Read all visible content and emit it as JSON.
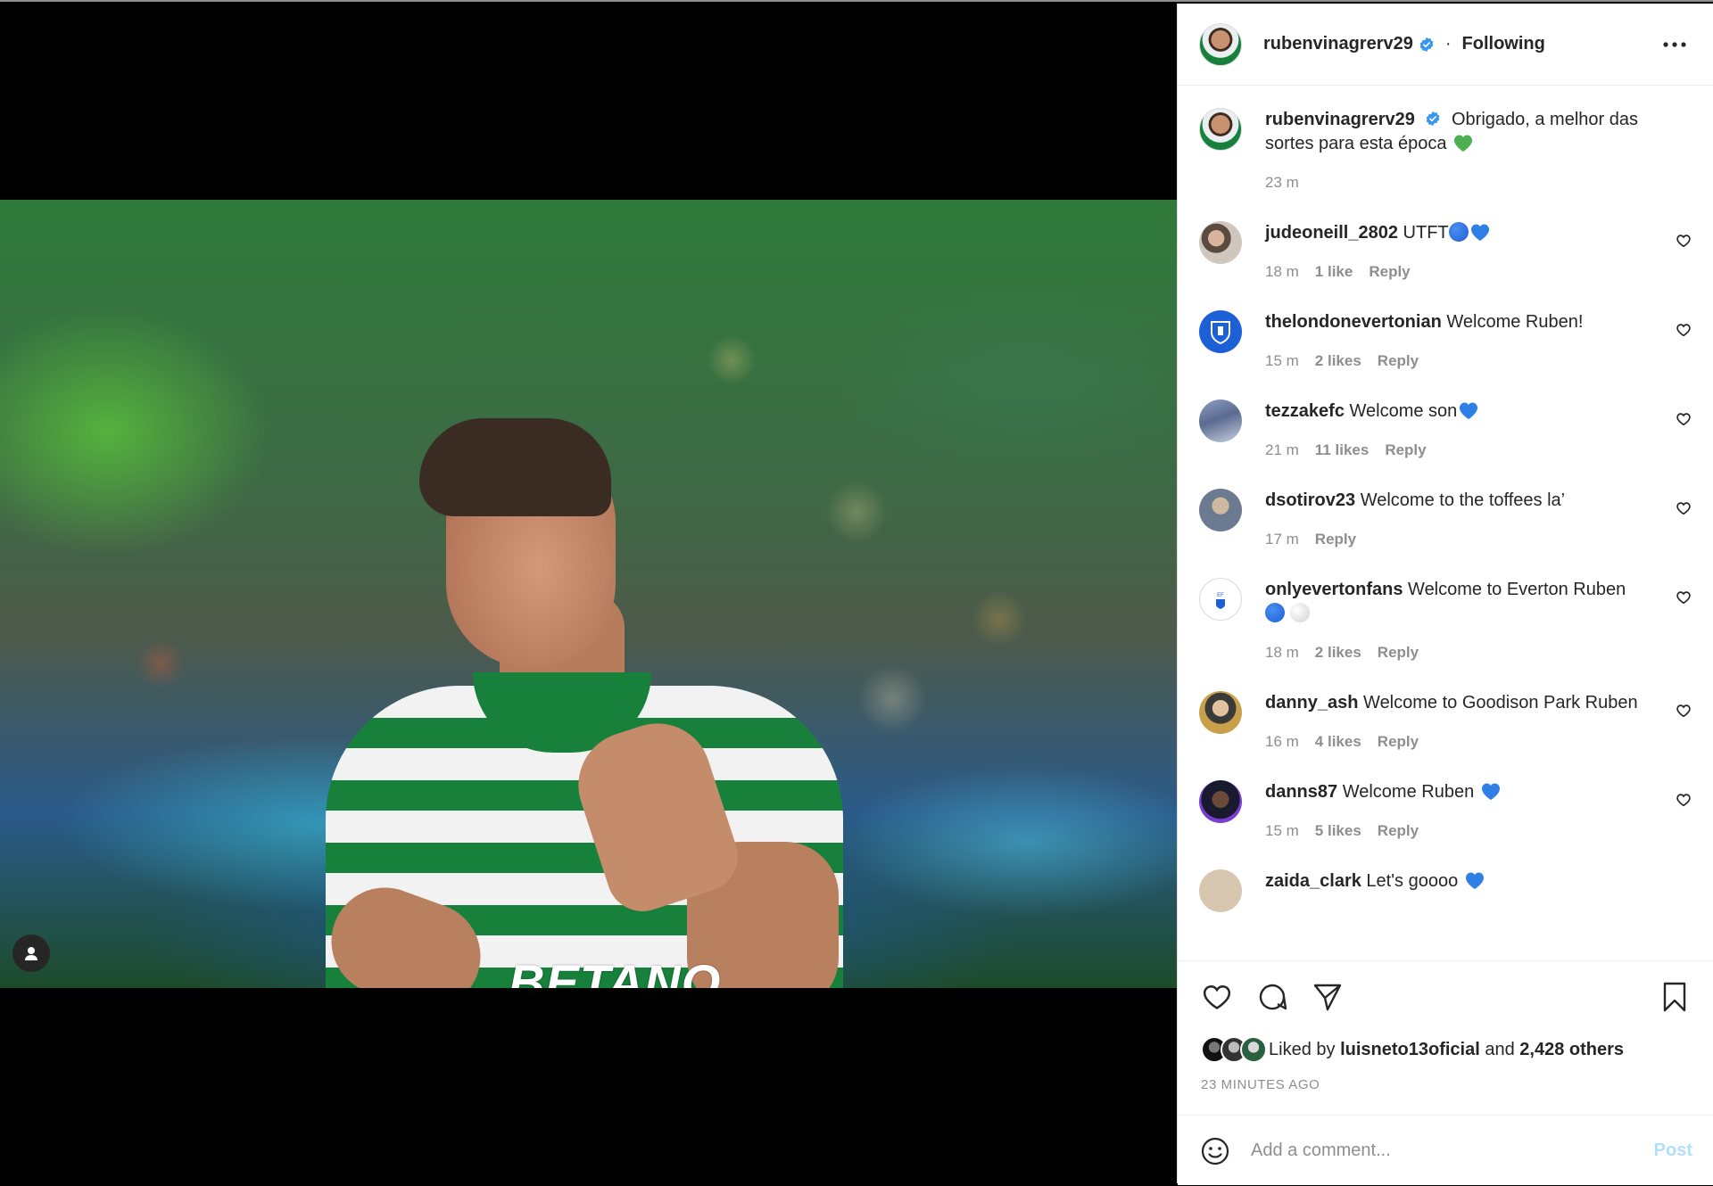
{
  "post": {
    "author": "rubenvinagrerv29",
    "follow_state": "Following",
    "dot": "·",
    "photo_sponsor_text": "BETANO"
  },
  "caption": {
    "user": "rubenvinagrerv29",
    "text": "Obrigado, a melhor das sortes para esta época",
    "time": "23 m"
  },
  "comments": [
    {
      "user": "judeoneill_2802",
      "text": "UTFT",
      "time": "18 m",
      "likes": "1 like",
      "reply": "Reply"
    },
    {
      "user": "thelondonevertonian",
      "text": "Welcome Ruben!",
      "time": "15 m",
      "likes": "2 likes",
      "reply": "Reply"
    },
    {
      "user": "tezzakefc",
      "text": "Welcome son",
      "time": "21 m",
      "likes": "11 likes",
      "reply": "Reply"
    },
    {
      "user": "dsotirov23",
      "text": "Welcome to the toffees la’",
      "time": "17 m",
      "likes": "",
      "reply": "Reply"
    },
    {
      "user": "onlyevertonfans",
      "text": "Welcome to Everton Ruben",
      "time": "18 m",
      "likes": "2 likes",
      "reply": "Reply"
    },
    {
      "user": "danny_ash",
      "text": "Welcome to Goodison Park Ruben",
      "time": "16 m",
      "likes": "4 likes",
      "reply": "Reply"
    },
    {
      "user": "danns87",
      "text": "Welcome Ruben",
      "time": "15 m",
      "likes": "5 likes",
      "reply": "Reply"
    },
    {
      "user": "zaida_clark",
      "text": "Let's goooo",
      "time": "",
      "likes": "",
      "reply": ""
    }
  ],
  "likes": {
    "prefix": "Liked by",
    "user": "luisneto13oficial",
    "joiner": "and",
    "others": "2,428 others"
  },
  "timestamp": "23 MINUTES AGO",
  "comment_box": {
    "placeholder": "Add a comment...",
    "post_label": "Post"
  },
  "colors": {
    "verified": "#3897f0",
    "green_heart": "#4caf50",
    "blue": "#1d5fd6",
    "link_disabled": "#b2dffc"
  },
  "icons": [
    "verified-badge-icon",
    "more-options-icon",
    "heart-icon",
    "comment-icon",
    "share-icon",
    "bookmark-icon",
    "emoji-icon",
    "user-tag-icon"
  ]
}
